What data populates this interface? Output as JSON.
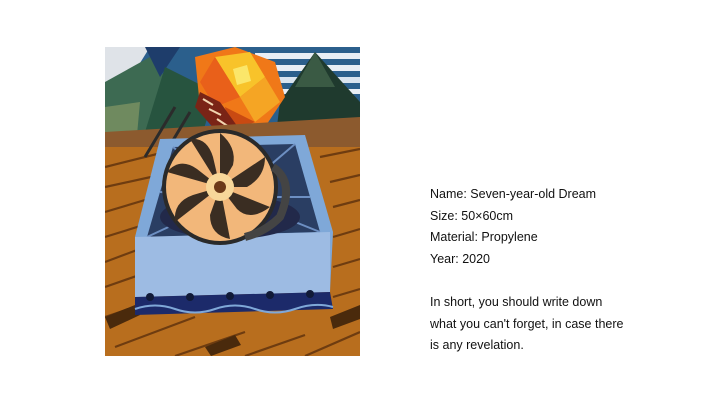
{
  "artwork": {
    "icon": "painting-image",
    "colors": {
      "sky": "#2b5f8c",
      "sun": "#f07818",
      "floor": "#b86e1e",
      "box": "#7fa8d8",
      "shell": "#f2b77a"
    }
  },
  "info": {
    "name": "Name: Seven-year-old Dream",
    "size": "Size: 50×60cm",
    "material": "Material: Propylene",
    "year": "Year: 2020",
    "description": "In short, you should write down what you can't forget, in case there is any revelation."
  }
}
